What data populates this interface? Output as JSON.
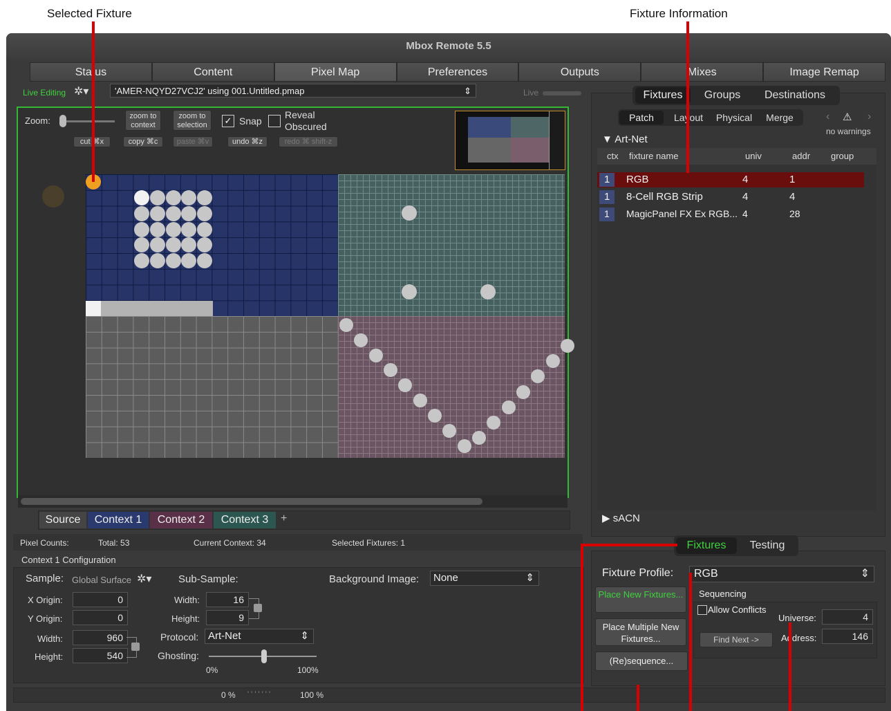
{
  "callouts": {
    "selected_fixture": "Selected Fixture",
    "fixture_information": "Fixture Information"
  },
  "window": {
    "title": "Mbox Remote 5.5"
  },
  "main_tabs": [
    {
      "label": "Status"
    },
    {
      "label": "Content"
    },
    {
      "label": "Pixel Map"
    },
    {
      "label": "Preferences"
    },
    {
      "label": "Outputs"
    },
    {
      "label": "Mixes"
    },
    {
      "label": "Image Remap"
    }
  ],
  "toolbar": {
    "live_editing": "Live Editing",
    "file_path": "'AMER-NQYD27VCJ2' using 001.Untitled.pmap",
    "live_label": "Live"
  },
  "map_controls": {
    "zoom_label": "Zoom:",
    "zoom_to_context": "zoom to context",
    "zoom_to_selection": "zoom to selection",
    "snap_label": "Snap",
    "snap_checked": true,
    "reveal_obscured_label": "Reveal Obscured",
    "reveal_checked": false,
    "cut": "cut ⌘x",
    "copy": "copy ⌘c",
    "paste": "paste ⌘v",
    "undo": "undo ⌘z",
    "redo": "redo ⌘ shift-z"
  },
  "context_tabs": [
    {
      "label": "Source",
      "color": "#454545"
    },
    {
      "label": "Context 1",
      "color": "#2a3a6e"
    },
    {
      "label": "Context 2",
      "color": "#5a3048"
    },
    {
      "label": "Context 3",
      "color": "#2c5650"
    }
  ],
  "pixel_counts": {
    "label": "Pixel Counts:",
    "total": "Total: 53",
    "current_context": "Current Context: 34",
    "selected_fixtures": "Selected Fixtures: 1"
  },
  "context_config": {
    "title": "Context 1 Configuration",
    "sample_label": "Sample:",
    "sample_value": "Global Surface",
    "sub_sample_label": "Sub-Sample:",
    "x_origin_label": "X Origin:",
    "x_origin": "0",
    "y_origin_label": "Y Origin:",
    "y_origin": "0",
    "width_label": "Width:",
    "width": "960",
    "height_label": "Height:",
    "height": "540",
    "sub_width_label": "Width:",
    "sub_width": "16",
    "sub_height_label": "Height:",
    "sub_height": "9",
    "protocol_label": "Protocol:",
    "protocol": "Art-Net",
    "ghosting_label": "Ghosting:",
    "ghosting_min": "0%",
    "ghosting_max": "100%",
    "bg_image_label": "Background Image:",
    "bg_image_value": "None"
  },
  "progress": {
    "min": "0 %",
    "max": "100 %"
  },
  "right_panel": {
    "top_tabs": [
      "Fixtures",
      "Groups",
      "Destinations"
    ],
    "sub_tabs": [
      "Patch",
      "Layout",
      "Physical",
      "Merge"
    ],
    "no_warnings": "no warnings",
    "art_net_label": "Art-Net",
    "sacn_label": "sACN",
    "columns": [
      "ctx",
      "fixture name",
      "univ",
      "addr",
      "group"
    ],
    "rows": [
      {
        "ctx": "1",
        "name": "RGB",
        "univ": "4",
        "addr": "1",
        "selected": true
      },
      {
        "ctx": "1",
        "name": "8-Cell RGB Strip",
        "univ": "4",
        "addr": "4",
        "selected": false
      },
      {
        "ctx": "1",
        "name": "MagicPanel FX Ex RGB...",
        "univ": "4",
        "addr": "28",
        "selected": false
      }
    ]
  },
  "bottom_right": {
    "tabs": [
      "Fixtures",
      "Testing"
    ],
    "fixture_profile_label": "Fixture Profile:",
    "fixture_profile": "RGB",
    "place_new": "Place New Fixtures...",
    "place_multiple": "Place Multiple New Fixtures...",
    "resequence": "(Re)sequence...",
    "sequencing_label": "Sequencing",
    "allow_conflicts": "Allow Conflicts",
    "universe_label": "Universe:",
    "universe": "4",
    "address_label": "Address:",
    "address": "146",
    "find_next": "Find Next ->"
  }
}
